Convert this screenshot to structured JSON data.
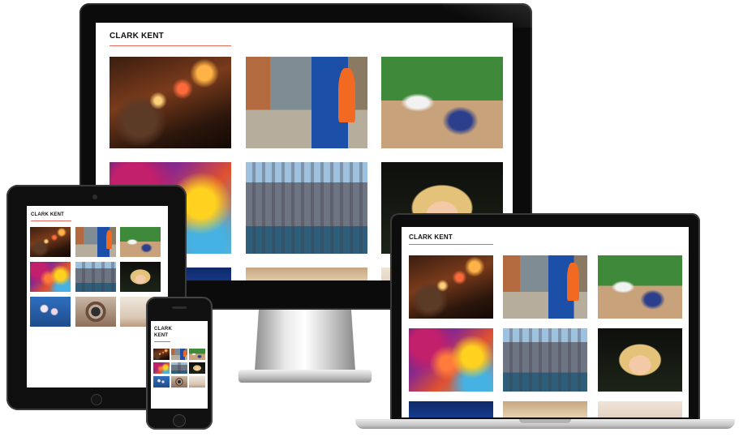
{
  "site": {
    "title": "CLARK KENT",
    "title_phone_line1": "CLARK",
    "title_phone_line2": "KENT",
    "accent_color": "#e4685a"
  },
  "gallery": {
    "photos": [
      {
        "name": "restaurant-lamps-photo",
        "style": "ph-restaurant"
      },
      {
        "name": "blue-wall-street-photo",
        "style": "ph-street"
      },
      {
        "name": "baseball-batter-photo",
        "style": "ph-baseball"
      },
      {
        "name": "colorful-blur-photo",
        "style": "ph-blur"
      },
      {
        "name": "city-skyline-photo",
        "style": "ph-city"
      },
      {
        "name": "curly-haired-girl-photo",
        "style": "ph-girl"
      },
      {
        "name": "orchid-flowers-photo",
        "style": "ph-orchid"
      },
      {
        "name": "mechanical-wheel-photo",
        "style": "ph-wheel"
      },
      {
        "name": "interior-room-photo",
        "style": "ph-room"
      }
    ]
  },
  "devices": {
    "desktop": "imac-monitor",
    "tablet": "ipad-tablet",
    "phone": "iphone",
    "laptop": "macbook-laptop"
  }
}
